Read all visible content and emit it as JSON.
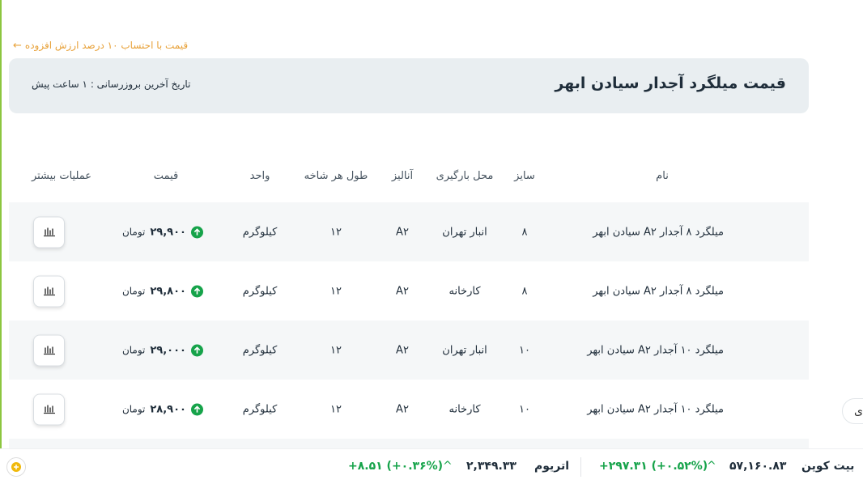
{
  "vat_link": "قیمت با احتساب ۱۰ درصد ارزش افزوده",
  "header": {
    "title": "قیمت میلگرد آجدار سیادن ابهر",
    "last_update": "تاریخ آخرین بروزرسانی : ۱ ساعت پیش"
  },
  "table": {
    "columns": [
      "نام",
      "سایز",
      "محل بارگیری",
      "آنالیز",
      "طول هر شاخه",
      "واحد",
      "قیمت",
      "عملیات بیشتر"
    ],
    "rows": [
      {
        "name": "میلگرد ۸ آجدار A۲ سیادن ابهر",
        "size": "۸",
        "location": "انبار تهران",
        "analysis": "A۲",
        "length": "۱۲",
        "unit": "کیلوگرم",
        "price": "۲۹,۹۰۰",
        "currency": "تومان"
      },
      {
        "name": "میلگرد ۸ آجدار A۲ سیادن ابهر",
        "size": "۸",
        "location": "کارخانه",
        "analysis": "A۲",
        "length": "۱۲",
        "unit": "کیلوگرم",
        "price": "۲۹,۸۰۰",
        "currency": "تومان"
      },
      {
        "name": "میلگرد ۱۰ آجدار A۲ سیادن ابهر",
        "size": "۱۰",
        "location": "انبار تهران",
        "analysis": "A۲",
        "length": "۱۲",
        "unit": "کیلوگرم",
        "price": "۲۹,۰۰۰",
        "currency": "تومان"
      },
      {
        "name": "میلگرد ۱۰ آجدار A۲ سیادن ابهر",
        "size": "۱۰",
        "location": "کارخانه",
        "analysis": "A۲",
        "length": "۱۲",
        "unit": "کیلوگرم",
        "price": "۲۸,۹۰۰",
        "currency": "تومان"
      }
    ]
  },
  "side_tab": "ی",
  "ticker": {
    "btc": {
      "name": "بیت کوین",
      "price": "۵۷,۱۶۰.۸۳",
      "change": "+۲۹۷.۳۱ (+۰.۵۲%)"
    },
    "eth": {
      "name": "اتریوم",
      "price": "۲,۳۴۹.۳۳",
      "change": "+۸.۵۱ (+۰.۳۶%)"
    }
  },
  "colors": {
    "accent": "#8cc63f",
    "up": "#16a34a",
    "link": "#e8a23a",
    "header_bg": "#e9eef1"
  }
}
